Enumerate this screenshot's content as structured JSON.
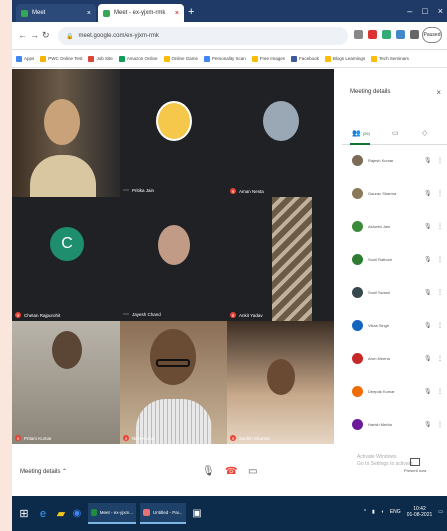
{
  "browser": {
    "tabs": [
      {
        "label": "Meet",
        "active": false
      },
      {
        "label": "Meet - ex-yjxm-rmk",
        "active": true
      }
    ],
    "new_tab_icon": "plus-icon",
    "url": "meet.google.com/ex-yjxm-rmk",
    "profile_label": "Paused",
    "bookmarks": [
      "Apps",
      "PWC Online Test",
      "Job Site",
      "Amazon Online",
      "Online Game",
      "Personality Scan",
      "Free Images",
      "Facebook",
      "Blogs Learnings",
      "Tech Seminars"
    ]
  },
  "participants_tiles": [
    {
      "name": "",
      "kind": "video",
      "color": "#4b3a2b"
    },
    {
      "name": "Pritika Jain",
      "kind": "avatar",
      "color": "#f5c84b"
    },
    {
      "name": "Aman Nesta",
      "kind": "avatar",
      "color": "#9aa7b5"
    },
    {
      "name": "Chetan Rajpurohit",
      "kind": "letter",
      "letter": "C",
      "color": "#1e8e6e"
    },
    {
      "name": "Jayesh Chand",
      "kind": "avatar",
      "color": "#c29b86"
    },
    {
      "name": "Ankit Yadav",
      "kind": "video",
      "color": "#8b7a66"
    },
    {
      "name": "Pritam Kumar",
      "kind": "video",
      "color": "#9c9486"
    },
    {
      "name": "Nitin Kumar",
      "kind": "video",
      "color": "#6a5747"
    },
    {
      "name": "Sachin Sharma",
      "kind": "video",
      "color": "#7a6048"
    }
  ],
  "panel": {
    "title": "Meeting details",
    "people_tab": "people-icon",
    "people_count": "(29)",
    "chat_tab": "chat-icon",
    "activity_tab": "activities-icon",
    "people": [
      {
        "name": "Rajesh Kumar",
        "color": "#7b6b57"
      },
      {
        "name": "Gaurav Sharma",
        "color": "#8a7a5a"
      },
      {
        "name": "Ashwini Jain",
        "color": "#3c8a3c"
      },
      {
        "name": "Sunil Rathore",
        "color": "#2e7d32"
      },
      {
        "name": "Sunil Swami",
        "color": "#37474f"
      },
      {
        "name": "Vikas Singh",
        "color": "#1565c0"
      },
      {
        "name": "Arun Meena",
        "color": "#c62828"
      },
      {
        "name": "Deepak Kumar",
        "color": "#ef6c00"
      },
      {
        "name": "Harish Mehta",
        "color": "#6a1b9a"
      }
    ]
  },
  "bottombar": {
    "meeting_details": "Meeting details",
    "activate_line1": "Activate Windows",
    "activate_line2": "Go to Settings to activate",
    "present_label": "Present now"
  },
  "taskbar": {
    "apps": [
      {
        "label": "Meet - ex-yjxm...",
        "color": "#1e8e3e"
      },
      {
        "label": "Untitled - Pai...",
        "color": "#e57373"
      }
    ],
    "time": "10:42",
    "date": "01-08-2021",
    "lang": "ENG"
  }
}
